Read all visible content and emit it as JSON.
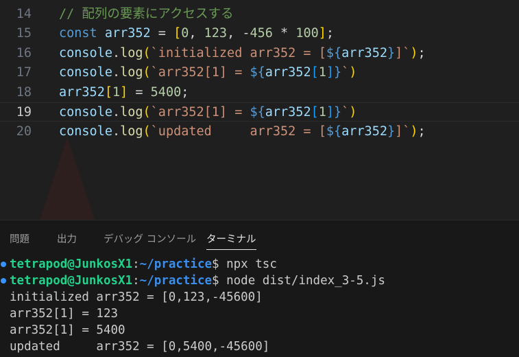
{
  "editor": {
    "lines": [
      {
        "num": "14",
        "active": false,
        "tokens": [
          {
            "t": "// 配列の要素にアクセスする",
            "c": "comment"
          }
        ]
      },
      {
        "num": "15",
        "active": false,
        "tokens": [
          {
            "t": "const",
            "c": "keyword"
          },
          {
            "t": " ",
            "c": "punct"
          },
          {
            "t": "arr352",
            "c": "ident"
          },
          {
            "t": " = ",
            "c": "punct"
          },
          {
            "t": "[",
            "c": "bracket1"
          },
          {
            "t": "0",
            "c": "number"
          },
          {
            "t": ", ",
            "c": "punct"
          },
          {
            "t": "123",
            "c": "number"
          },
          {
            "t": ", ",
            "c": "punct"
          },
          {
            "t": "-",
            "c": "punct"
          },
          {
            "t": "456",
            "c": "number"
          },
          {
            "t": " * ",
            "c": "punct"
          },
          {
            "t": "100",
            "c": "number"
          },
          {
            "t": "]",
            "c": "bracket1"
          },
          {
            "t": ";",
            "c": "punct"
          }
        ]
      },
      {
        "num": "16",
        "active": false,
        "tokens": [
          {
            "t": "console",
            "c": "ident"
          },
          {
            "t": ".",
            "c": "punct"
          },
          {
            "t": "log",
            "c": "func"
          },
          {
            "t": "(",
            "c": "bracket1"
          },
          {
            "t": "`initialized arr352 = [",
            "c": "string"
          },
          {
            "t": "${",
            "c": "interp"
          },
          {
            "t": "arr352",
            "c": "ident"
          },
          {
            "t": "}",
            "c": "interp"
          },
          {
            "t": "]`",
            "c": "string"
          },
          {
            "t": ")",
            "c": "bracket1"
          },
          {
            "t": ";",
            "c": "punct"
          }
        ]
      },
      {
        "num": "17",
        "active": false,
        "tokens": [
          {
            "t": "console",
            "c": "ident"
          },
          {
            "t": ".",
            "c": "punct"
          },
          {
            "t": "log",
            "c": "func"
          },
          {
            "t": "(",
            "c": "bracket1"
          },
          {
            "t": "`arr352[1] = ",
            "c": "string"
          },
          {
            "t": "${",
            "c": "interp"
          },
          {
            "t": "arr352",
            "c": "ident"
          },
          {
            "t": "[",
            "c": "bracket3"
          },
          {
            "t": "1",
            "c": "number"
          },
          {
            "t": "]",
            "c": "bracket3"
          },
          {
            "t": "}",
            "c": "interp"
          },
          {
            "t": "`",
            "c": "string"
          },
          {
            "t": ")",
            "c": "bracket1"
          }
        ]
      },
      {
        "num": "18",
        "active": false,
        "tokens": [
          {
            "t": "arr352",
            "c": "ident"
          },
          {
            "t": "[",
            "c": "bracket1"
          },
          {
            "t": "1",
            "c": "number"
          },
          {
            "t": "]",
            "c": "bracket1"
          },
          {
            "t": " = ",
            "c": "punct"
          },
          {
            "t": "5400",
            "c": "number"
          },
          {
            "t": ";",
            "c": "punct"
          }
        ]
      },
      {
        "num": "19",
        "active": true,
        "tokens": [
          {
            "t": "console",
            "c": "ident"
          },
          {
            "t": ".",
            "c": "punct"
          },
          {
            "t": "log",
            "c": "func"
          },
          {
            "t": "(",
            "c": "bracket1"
          },
          {
            "t": "`arr352[1] = ",
            "c": "string"
          },
          {
            "t": "${",
            "c": "interp"
          },
          {
            "t": "arr352",
            "c": "ident"
          },
          {
            "t": "[",
            "c": "bracket3"
          },
          {
            "t": "1",
            "c": "number"
          },
          {
            "t": "]",
            "c": "bracket3"
          },
          {
            "t": "}",
            "c": "interp"
          },
          {
            "t": "`",
            "c": "string"
          },
          {
            "t": ")",
            "c": "bracket1"
          }
        ]
      },
      {
        "num": "20",
        "active": false,
        "tokens": [
          {
            "t": "console",
            "c": "ident"
          },
          {
            "t": ".",
            "c": "punct"
          },
          {
            "t": "log",
            "c": "func"
          },
          {
            "t": "(",
            "c": "bracket1"
          },
          {
            "t": "`updated     arr352 = [",
            "c": "string"
          },
          {
            "t": "${",
            "c": "interp"
          },
          {
            "t": "arr352",
            "c": "ident"
          },
          {
            "t": "}",
            "c": "interp"
          },
          {
            "t": "]`",
            "c": "string"
          },
          {
            "t": ")",
            "c": "bracket1"
          },
          {
            "t": ";",
            "c": "punct"
          }
        ]
      }
    ]
  },
  "panel": {
    "tabs": [
      {
        "label": "問題",
        "active": false
      },
      {
        "label": "出力",
        "active": false
      },
      {
        "label": "デバッグ コンソール",
        "active": false
      },
      {
        "label": "ターミナル",
        "active": true
      }
    ]
  },
  "terminal": {
    "lines": [
      {
        "dot": true,
        "user": "tetrapod@JunkosX1",
        "sep": ":",
        "path": "~/practice",
        "sign": "$",
        "cmd": " npx tsc"
      },
      {
        "dot": true,
        "user": "tetrapod@JunkosX1",
        "sep": ":",
        "path": "~/practice",
        "sign": "$",
        "cmd": " node dist/index_3-5.js"
      },
      {
        "dot": false,
        "text": "initialized arr352 = [0,123,-45600]"
      },
      {
        "dot": false,
        "text": "arr352[1] = 123"
      },
      {
        "dot": false,
        "text": "arr352[1] = 5400"
      },
      {
        "dot": false,
        "text": "updated     arr352 = [0,5400,-45600]"
      }
    ]
  },
  "colors": {
    "dot": "#3794ff",
    "prompt_user": "#23d18b",
    "prompt_path": "#3b8eea"
  }
}
